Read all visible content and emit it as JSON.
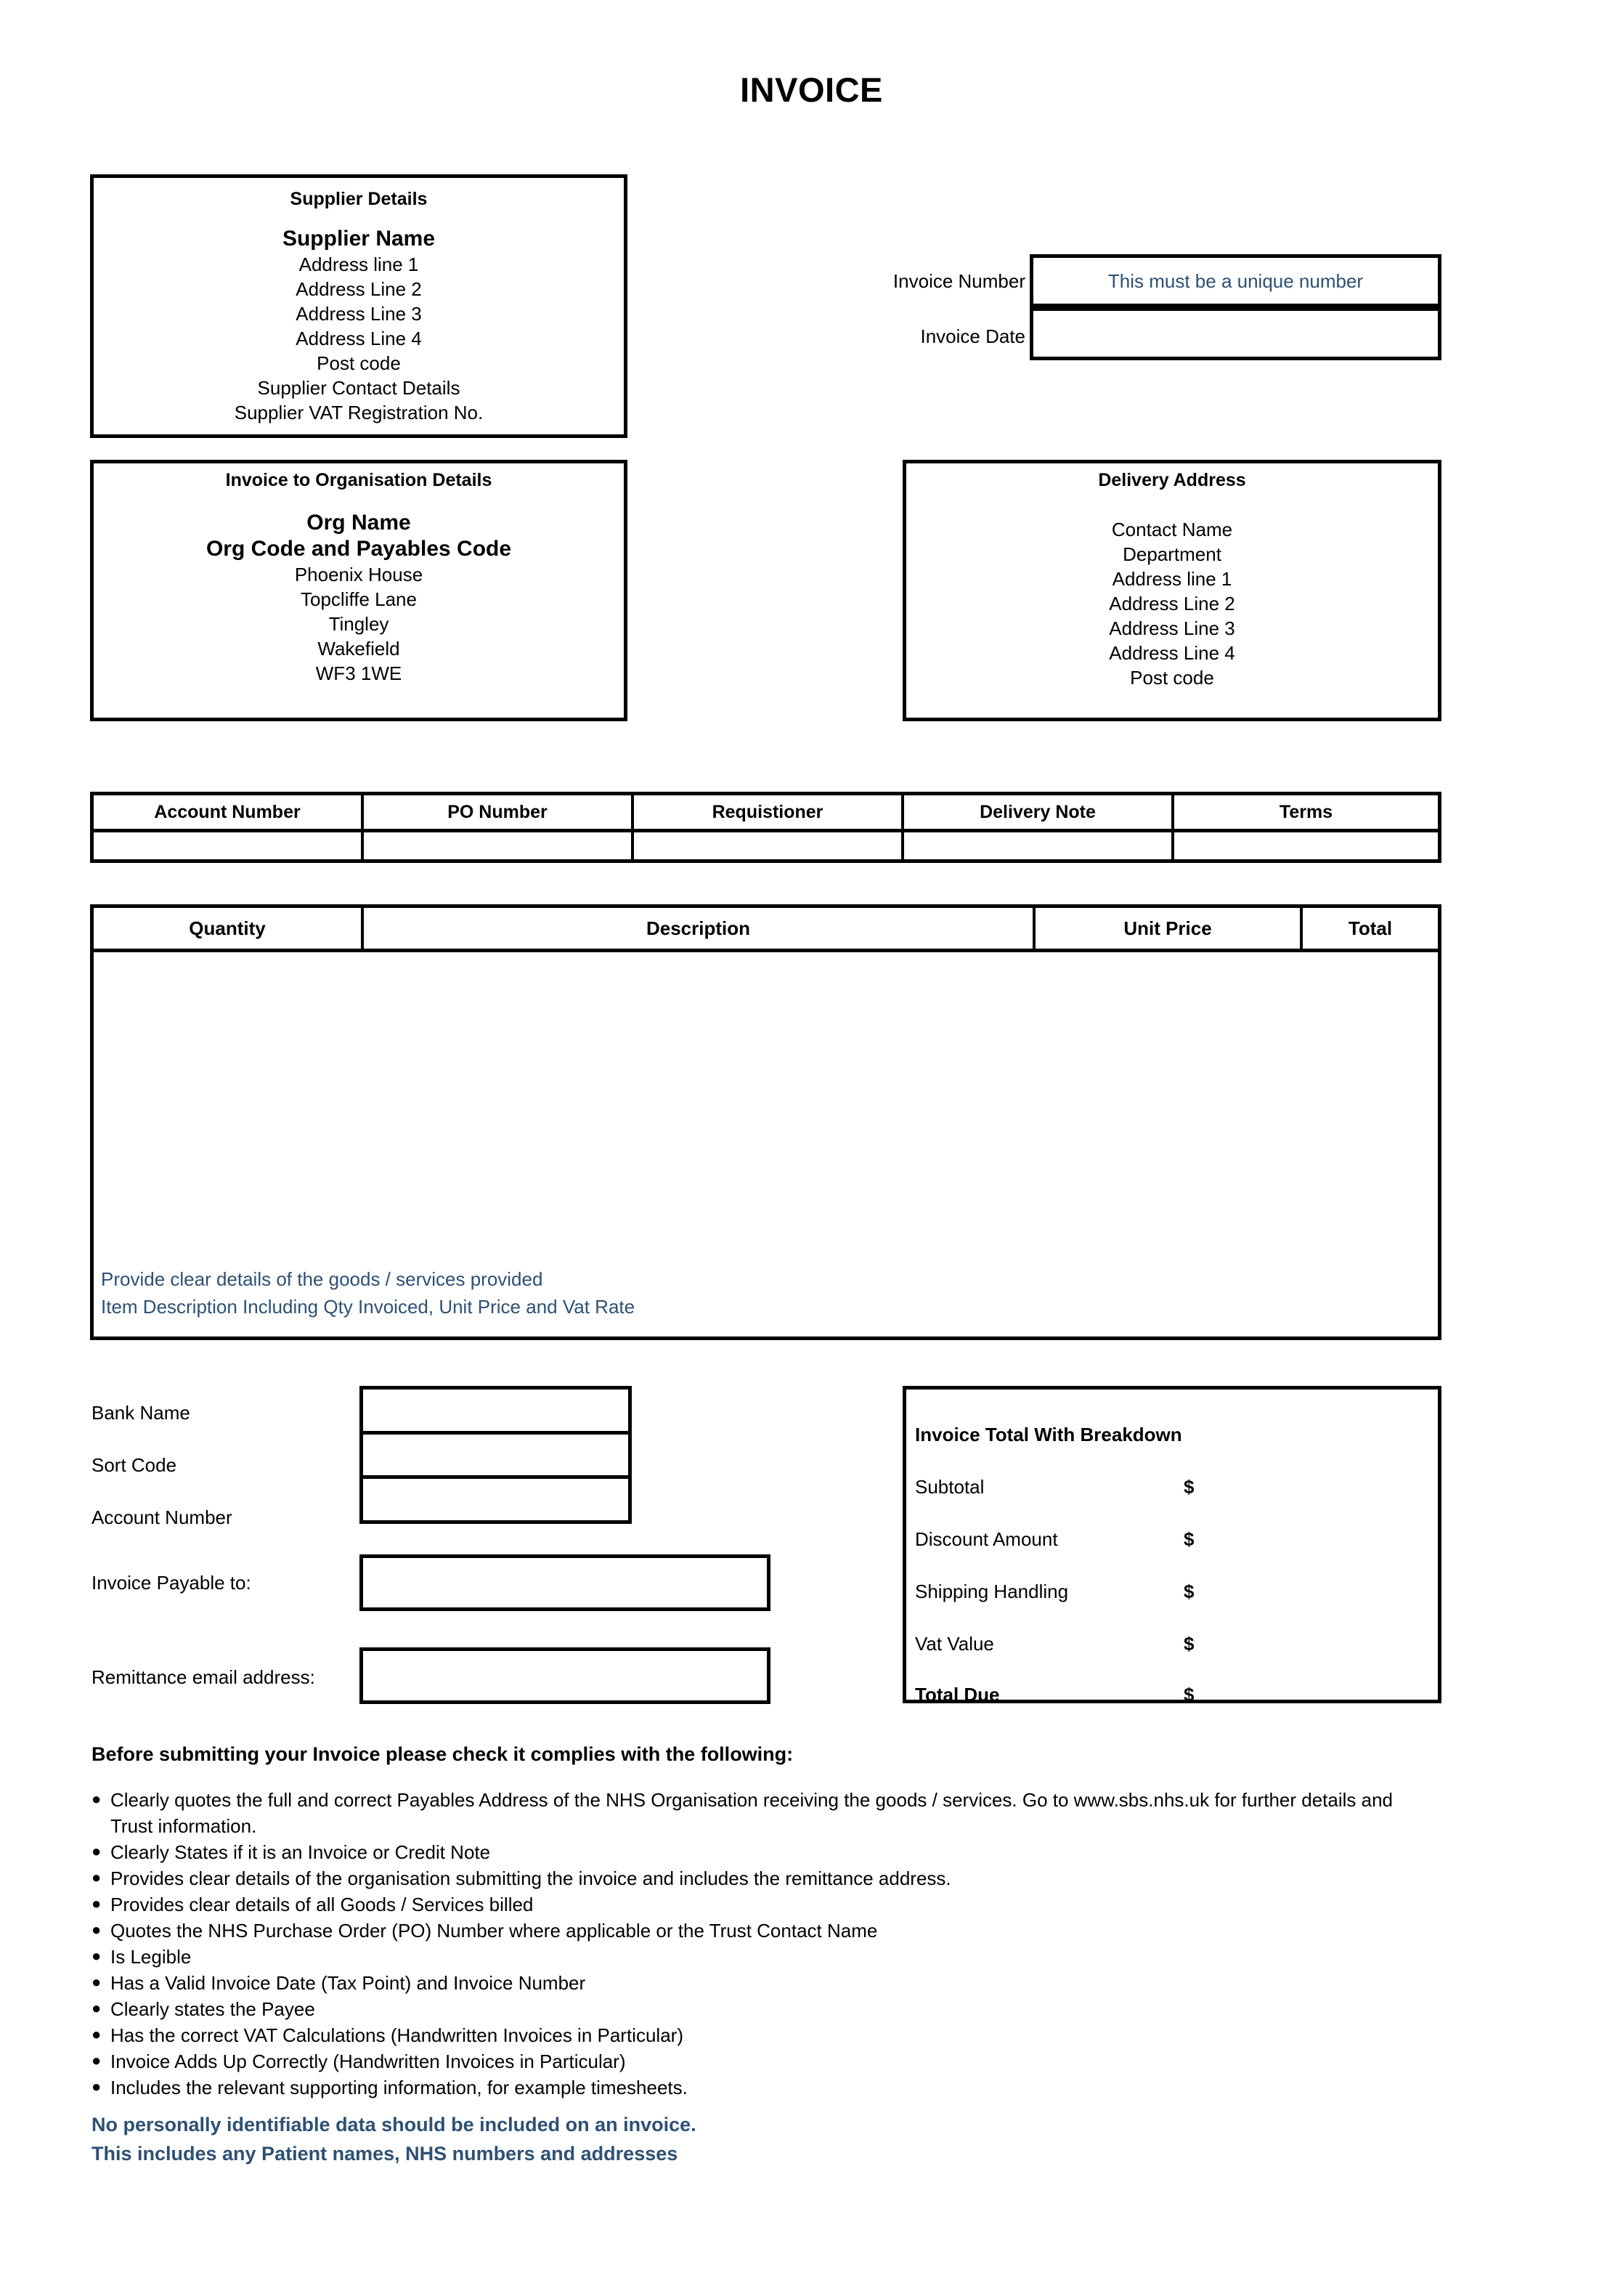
{
  "title": "INVOICE",
  "supplier": {
    "heading": "Supplier Details",
    "name": "Supplier Name",
    "lines": [
      "Address line 1",
      "Address Line 2",
      "Address Line 3",
      "Address Line 4",
      "Post code",
      "Supplier Contact Details",
      "Supplier VAT Registration No."
    ]
  },
  "invoice_meta": {
    "number_label": "Invoice Number",
    "number_value": "This must be a unique number",
    "date_label": "Invoice Date",
    "date_value": "",
    "hint_color": "#2e5073"
  },
  "organisation": {
    "heading": "Invoice to Organisation Details",
    "name": "Org Name",
    "code": "Org Code and Payables Code",
    "lines": [
      "Phoenix House",
      "Topcliffe Lane",
      "Tingley",
      "Wakefield",
      "WF3 1WE"
    ]
  },
  "delivery": {
    "heading": "Delivery Address",
    "lines": [
      "Contact Name",
      "Department",
      "Address line 1",
      "Address Line 2",
      "Address Line 3",
      "Address Line 4",
      "Post code"
    ]
  },
  "account_table": {
    "headers": [
      "Account Number",
      "PO Number",
      "Requistioner",
      "Delivery Note",
      "Terms"
    ],
    "values": [
      "",
      "",
      "",
      "",
      ""
    ]
  },
  "items_table": {
    "headers": [
      "Quantity",
      "Description",
      "Unit Price",
      "Total"
    ],
    "hint_line_1": "Provide clear details of the goods / services provided",
    "hint_line_2": "Item Description Including Qty Invoiced, Unit Price and Vat Rate"
  },
  "bank": {
    "bank_name_label": "Bank Name",
    "sort_code_label": "Sort Code",
    "account_number_label": "Account Number",
    "payable_label": "Invoice Payable to:",
    "remittance_label": "Remittance email address:",
    "bank_name_value": "",
    "sort_code_value": "",
    "account_number_value": "",
    "payable_value": "",
    "remittance_value": ""
  },
  "totals": {
    "heading": "Invoice Total With Breakdown",
    "rows": [
      {
        "label": "Subtotal",
        "value": "$"
      },
      {
        "label": "Discount Amount",
        "value": "$"
      },
      {
        "label": "Shipping  Handling",
        "value": "$"
      },
      {
        "label": "Vat Value",
        "value": "$"
      },
      {
        "label": "Total Due",
        "value": "$"
      }
    ]
  },
  "checklist": {
    "heading": "Before submitting your Invoice please check it complies with the following:",
    "bullet": "●",
    "items": [
      "Clearly quotes the full and correct Payables Address of the NHS Organisation receiving the goods / services. Go to www.sbs.nhs.uk for further details and Trust information.",
      "Clearly States if it is an Invoice or Credit Note",
      "Provides clear details of the organisation submitting the invoice and includes the remittance address.",
      "Provides clear details of all Goods / Services billed",
      "Quotes the NHS Purchase Order (PO) Number where applicable or the Trust Contact Name",
      "Is Legible",
      "Has a Valid Invoice Date (Tax Point) and Invoice Number",
      "Clearly states the Payee",
      "Has the correct VAT Calculations (Handwritten Invoices in Particular)",
      "Invoice Adds Up Correctly (Handwritten Invoices in Particular)",
      "Includes the relevant supporting information, for example timesheets."
    ]
  },
  "warning": {
    "line_1": "No personally identifiable data should be included on an invoice.",
    "line_2": "This includes any Patient names, NHS numbers and addresses",
    "color": "#2e5073"
  }
}
